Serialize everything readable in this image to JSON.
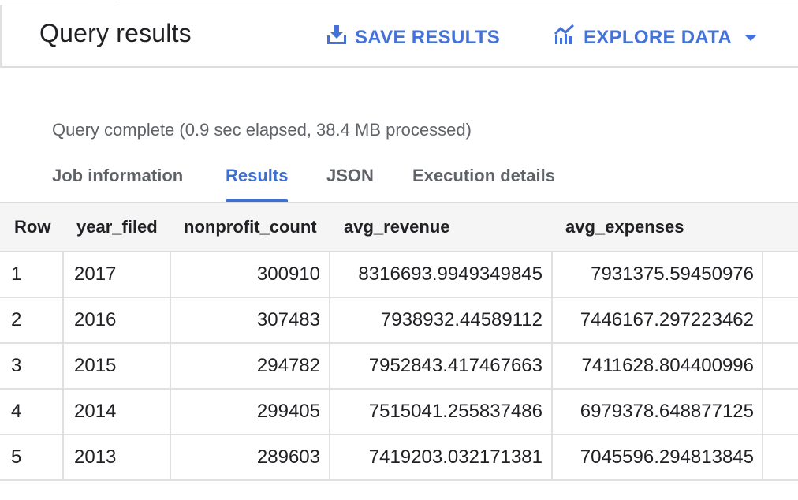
{
  "header": {
    "title": "Query results",
    "save_label": "SAVE RESULTS",
    "explore_label": "EXPLORE DATA"
  },
  "status": "Query complete (0.9 sec elapsed, 38.4 MB processed)",
  "tabs": [
    {
      "label": "Job information",
      "active": false
    },
    {
      "label": "Results",
      "active": true
    },
    {
      "label": "JSON",
      "active": false
    },
    {
      "label": "Execution details",
      "active": false
    }
  ],
  "table": {
    "columns": [
      "Row",
      "year_filed",
      "nonprofit_count",
      "avg_revenue",
      "avg_expenses"
    ],
    "rows": [
      [
        "1",
        "2017",
        "300910",
        "8316693.9949349845",
        "7931375.59450976"
      ],
      [
        "2",
        "2016",
        "307483",
        "7938932.44589112",
        "7446167.297223462"
      ],
      [
        "3",
        "2015",
        "294782",
        "7952843.417467663",
        "7411628.804400996"
      ],
      [
        "4",
        "2014",
        "299405",
        "7515041.255837486",
        "6979378.648877125"
      ],
      [
        "5",
        "2013",
        "289603",
        "7419203.032171381",
        "7045596.294813845"
      ]
    ]
  },
  "colors": {
    "accent": "#4472d8",
    "active_tab": "#3c6fd1",
    "text": "#202124",
    "muted": "#5f6368",
    "border": "#dadce0"
  },
  "icons": {
    "save": "download-icon",
    "explore": "chart-icon",
    "dropdown": "caret-down-icon"
  }
}
